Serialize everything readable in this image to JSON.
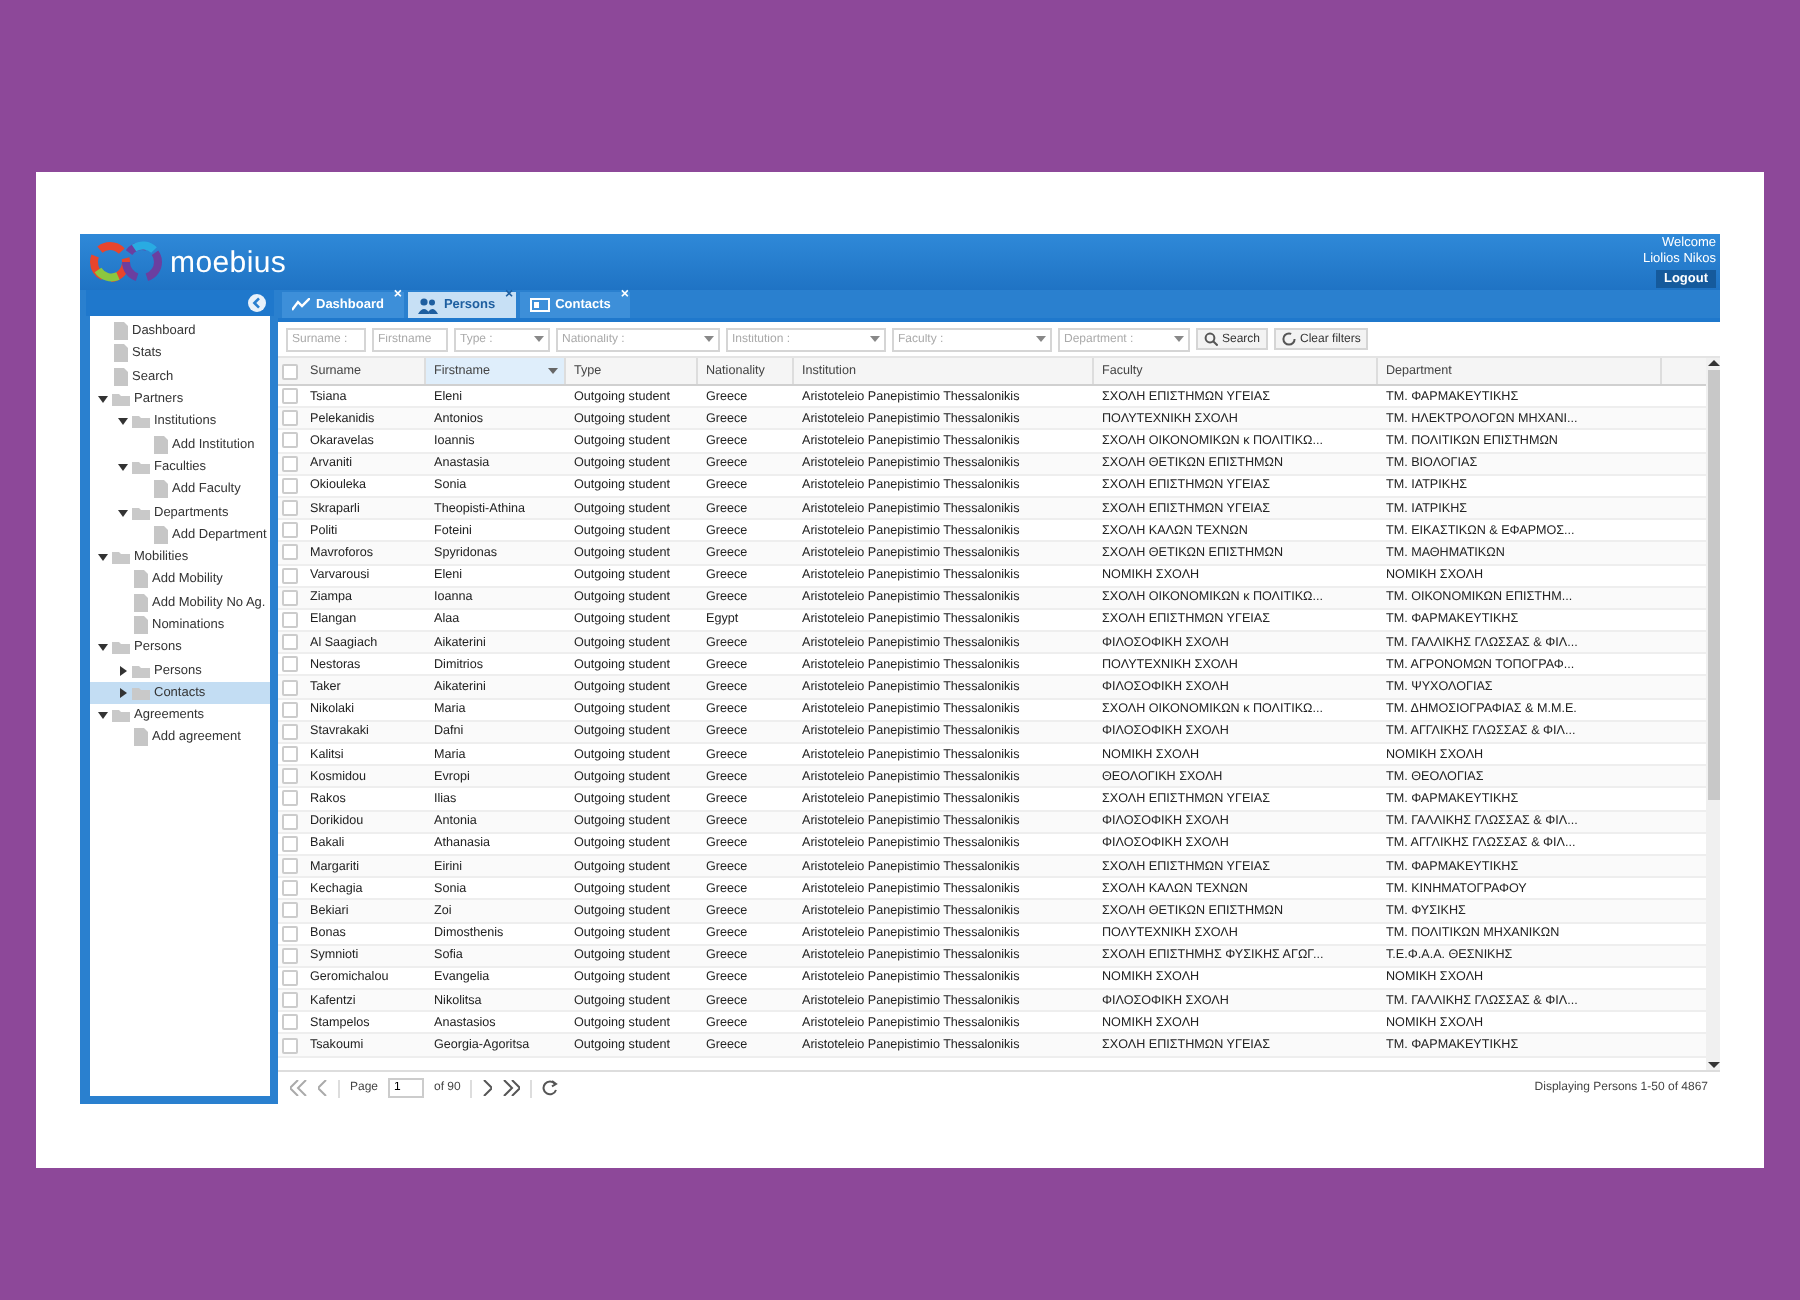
{
  "header": {
    "logo": "moebius",
    "welcome": "Welcome",
    "user": "Liolios Nikos",
    "logout": "Logout"
  },
  "tabs": [
    {
      "label": "Dashboard",
      "close": "×",
      "selected": false
    },
    {
      "label": "Persons",
      "close": "×",
      "selected": true
    },
    {
      "label": "Contacts",
      "close": "×",
      "selected": false
    }
  ],
  "sidebar": {
    "items": [
      {
        "label": "Dashboard",
        "kind": "leaf",
        "selected": false
      },
      {
        "label": "Stats",
        "kind": "leaf",
        "selected": false
      },
      {
        "label": "Search",
        "kind": "leaf",
        "selected": false
      },
      {
        "label": "Partners",
        "kind": "folder",
        "expanded": true,
        "selected": false,
        "children": [
          {
            "label": "Institutions",
            "kind": "folder",
            "expanded": true,
            "selected": false,
            "children": [
              {
                "label": "Add Institution",
                "kind": "leaf",
                "selected": false
              }
            ]
          },
          {
            "label": "Faculties",
            "kind": "folder",
            "expanded": true,
            "selected": false,
            "children": [
              {
                "label": "Add Faculty",
                "kind": "leaf",
                "selected": false
              }
            ]
          },
          {
            "label": "Departments",
            "kind": "folder",
            "expanded": true,
            "selected": false,
            "children": [
              {
                "label": "Add Department",
                "kind": "leaf",
                "selected": false
              }
            ]
          }
        ]
      },
      {
        "label": "Mobilities",
        "kind": "folder",
        "expanded": true,
        "selected": false,
        "children": [
          {
            "label": "Add Mobility",
            "kind": "leaf",
            "selected": false
          },
          {
            "label": "Add Mobility No Ag.",
            "kind": "leaf",
            "selected": false
          },
          {
            "label": "Nominations",
            "kind": "leaf",
            "selected": false
          }
        ]
      },
      {
        "label": "Persons",
        "kind": "folder",
        "expanded": true,
        "selected": false,
        "children": [
          {
            "label": "Persons",
            "kind": "folder",
            "expanded": false,
            "selected": false
          },
          {
            "label": "Contacts",
            "kind": "folder",
            "expanded": false,
            "selected": true
          }
        ]
      },
      {
        "label": "Agreements",
        "kind": "folder",
        "expanded": true,
        "selected": false,
        "children": [
          {
            "label": "Add agreement",
            "kind": "leaf",
            "selected": false
          }
        ]
      }
    ]
  },
  "filters": [
    {
      "placeholder": "Surname :",
      "kind": "text"
    },
    {
      "placeholder": "Firstname",
      "kind": "text"
    },
    {
      "placeholder": "Type :",
      "kind": "combo"
    },
    {
      "placeholder": "Nationality :",
      "kind": "combo"
    },
    {
      "placeholder": "Institution :",
      "kind": "combo"
    },
    {
      "placeholder": "Faculty :",
      "kind": "combo"
    },
    {
      "placeholder": "Department :",
      "kind": "combo"
    }
  ],
  "filter_buttons": [
    {
      "label": "Search",
      "kind": "search"
    },
    {
      "label": "Clear filters",
      "kind": "clear"
    }
  ],
  "table": {
    "select_all": {
      "checked": false
    },
    "columns": [
      {
        "label": "Surname",
        "active": false
      },
      {
        "label": "Firstname",
        "active": true
      },
      {
        "label": "Type",
        "active": false
      },
      {
        "label": "Nationality",
        "active": false
      },
      {
        "label": "Institution",
        "active": false
      },
      {
        "label": "Faculty",
        "active": false
      },
      {
        "label": "Department",
        "active": false
      }
    ],
    "rows": [
      {
        "checked": false,
        "cells": [
          "Tsiana",
          "Eleni",
          "Outgoing student",
          "Greece",
          "Aristoteleio Panepistimio Thessalonikis",
          "ΣΧΟΛΗ ΕΠΙΣΤΗΜΩΝ ΥΓΕΙΑΣ",
          "ΤΜ. ΦΑΡΜΑΚΕΥΤΙΚΗΣ"
        ]
      },
      {
        "checked": false,
        "cells": [
          "Pelekanidis",
          "Antonios",
          "Outgoing student",
          "Greece",
          "Aristoteleio Panepistimio Thessalonikis",
          "ΠΟΛΥΤΕΧΝΙΚΗ ΣΧΟΛΗ",
          "ΤΜ. ΗΛΕΚΤΡΟΛΟΓΩΝ ΜΗΧΑΝΙ..."
        ]
      },
      {
        "checked": false,
        "cells": [
          "Okaravelas",
          "Ioannis",
          "Outgoing student",
          "Greece",
          "Aristoteleio Panepistimio Thessalonikis",
          "ΣΧΟΛΗ ΟΙΚΟΝΟΜΙΚΩΝ κ ΠΟΛΙΤΙΚΩ...",
          "ΤΜ. ΠΟΛΙΤΙΚΩΝ ΕΠΙΣΤΗΜΩΝ"
        ]
      },
      {
        "checked": false,
        "cells": [
          "Arvaniti",
          "Anastasia",
          "Outgoing student",
          "Greece",
          "Aristoteleio Panepistimio Thessalonikis",
          "ΣΧΟΛΗ ΘΕΤΙΚΩΝ ΕΠΙΣΤΗΜΩΝ",
          "ΤΜ. ΒΙΟΛΟΓΙΑΣ"
        ]
      },
      {
        "checked": false,
        "cells": [
          "Okiouleka",
          "Sonia",
          "Outgoing student",
          "Greece",
          "Aristoteleio Panepistimio Thessalonikis",
          "ΣΧΟΛΗ ΕΠΙΣΤΗΜΩΝ ΥΓΕΙΑΣ",
          "ΤΜ. ΙΑΤΡΙΚΗΣ"
        ]
      },
      {
        "checked": false,
        "cells": [
          "Skraparli",
          "Theopisti-Athina",
          "Outgoing student",
          "Greece",
          "Aristoteleio Panepistimio Thessalonikis",
          "ΣΧΟΛΗ ΕΠΙΣΤΗΜΩΝ ΥΓΕΙΑΣ",
          "ΤΜ. ΙΑΤΡΙΚΗΣ"
        ]
      },
      {
        "checked": false,
        "cells": [
          "Politi",
          "Foteini",
          "Outgoing student",
          "Greece",
          "Aristoteleio Panepistimio Thessalonikis",
          "ΣΧΟΛΗ ΚΑΛΩΝ ΤΕΧΝΩΝ",
          "ΤΜ. ΕΙΚΑΣΤΙΚΩΝ & ΕΦΑΡΜΟΣ..."
        ]
      },
      {
        "checked": false,
        "cells": [
          "Mavroforos",
          "Spyridonas",
          "Outgoing student",
          "Greece",
          "Aristoteleio Panepistimio Thessalonikis",
          "ΣΧΟΛΗ ΘΕΤΙΚΩΝ ΕΠΙΣΤΗΜΩΝ",
          "ΤΜ. ΜΑΘΗΜΑΤΙΚΩΝ"
        ]
      },
      {
        "checked": false,
        "cells": [
          "Varvarousi",
          "Eleni",
          "Outgoing student",
          "Greece",
          "Aristoteleio Panepistimio Thessalonikis",
          "ΝΟΜΙΚΗ ΣΧΟΛΗ",
          "ΝΟΜΙΚΗ ΣΧΟΛΗ"
        ]
      },
      {
        "checked": false,
        "cells": [
          "Ziampa",
          "Ioanna",
          "Outgoing student",
          "Greece",
          "Aristoteleio Panepistimio Thessalonikis",
          "ΣΧΟΛΗ ΟΙΚΟΝΟΜΙΚΩΝ κ ΠΟΛΙΤΙΚΩ...",
          "ΤΜ. ΟΙΚΟΝΟΜΙΚΩΝ ΕΠΙΣΤΗΜ..."
        ]
      },
      {
        "checked": false,
        "cells": [
          "Elangan",
          "Alaa",
          "Outgoing student",
          "Egypt",
          "Aristoteleio Panepistimio Thessalonikis",
          "ΣΧΟΛΗ ΕΠΙΣΤΗΜΩΝ ΥΓΕΙΑΣ",
          "ΤΜ. ΦΑΡΜΑΚΕΥΤΙΚΗΣ"
        ]
      },
      {
        "checked": false,
        "cells": [
          "Al Saagiach",
          "Aikaterini",
          "Outgoing student",
          "Greece",
          "Aristoteleio Panepistimio Thessalonikis",
          "ΦΙΛΟΣΟΦΙΚΗ ΣΧΟΛΗ",
          "ΤΜ. ΓΑΛΛΙΚΗΣ ΓΛΩΣΣΑΣ & ΦΙΛ..."
        ]
      },
      {
        "checked": false,
        "cells": [
          "Nestoras",
          "Dimitrios",
          "Outgoing student",
          "Greece",
          "Aristoteleio Panepistimio Thessalonikis",
          "ΠΟΛΥΤΕΧΝΙΚΗ ΣΧΟΛΗ",
          "ΤΜ. ΑΓΡΟΝΟΜΩΝ ΤΟΠΟΓΡΑΦ..."
        ]
      },
      {
        "checked": false,
        "cells": [
          "Taker",
          "Aikaterini",
          "Outgoing student",
          "Greece",
          "Aristoteleio Panepistimio Thessalonikis",
          "ΦΙΛΟΣΟΦΙΚΗ ΣΧΟΛΗ",
          "ΤΜ. ΨΥΧΟΛΟΓΙΑΣ"
        ]
      },
      {
        "checked": false,
        "cells": [
          "Nikolaki",
          "Maria",
          "Outgoing student",
          "Greece",
          "Aristoteleio Panepistimio Thessalonikis",
          "ΣΧΟΛΗ ΟΙΚΟΝΟΜΙΚΩΝ κ ΠΟΛΙΤΙΚΩ...",
          "ΤΜ. ΔΗΜΟΣΙΟΓΡΑΦΙΑΣ & Μ.Μ.Ε."
        ]
      },
      {
        "checked": false,
        "cells": [
          "Stavrakaki",
          "Dafni",
          "Outgoing student",
          "Greece",
          "Aristoteleio Panepistimio Thessalonikis",
          "ΦΙΛΟΣΟΦΙΚΗ ΣΧΟΛΗ",
          "ΤΜ. ΑΓΓΛΙΚΗΣ ΓΛΩΣΣΑΣ & ΦΙΛ..."
        ]
      },
      {
        "checked": false,
        "cells": [
          "Kalitsi",
          "Maria",
          "Outgoing student",
          "Greece",
          "Aristoteleio Panepistimio Thessalonikis",
          "ΝΟΜΙΚΗ ΣΧΟΛΗ",
          "ΝΟΜΙΚΗ ΣΧΟΛΗ"
        ]
      },
      {
        "checked": false,
        "cells": [
          "Kosmidou",
          "Evropi",
          "Outgoing student",
          "Greece",
          "Aristoteleio Panepistimio Thessalonikis",
          "ΘΕΟΛΟΓΙΚΗ ΣΧΟΛΗ",
          "ΤΜ. ΘΕΟΛΟΓΙΑΣ"
        ]
      },
      {
        "checked": false,
        "cells": [
          "Rakos",
          "Ilias",
          "Outgoing student",
          "Greece",
          "Aristoteleio Panepistimio Thessalonikis",
          "ΣΧΟΛΗ ΕΠΙΣΤΗΜΩΝ ΥΓΕΙΑΣ",
          "ΤΜ. ΦΑΡΜΑΚΕΥΤΙΚΗΣ"
        ]
      },
      {
        "checked": false,
        "cells": [
          "Dorikidou",
          "Antonia",
          "Outgoing student",
          "Greece",
          "Aristoteleio Panepistimio Thessalonikis",
          "ΦΙΛΟΣΟΦΙΚΗ ΣΧΟΛΗ",
          "ΤΜ. ΓΑΛΛΙΚΗΣ ΓΛΩΣΣΑΣ & ΦΙΛ..."
        ]
      },
      {
        "checked": false,
        "cells": [
          "Bakali",
          "Athanasia",
          "Outgoing student",
          "Greece",
          "Aristoteleio Panepistimio Thessalonikis",
          "ΦΙΛΟΣΟΦΙΚΗ ΣΧΟΛΗ",
          "ΤΜ. ΑΓΓΛΙΚΗΣ ΓΛΩΣΣΑΣ & ΦΙΛ..."
        ]
      },
      {
        "checked": false,
        "cells": [
          "Margariti",
          "Eirini",
          "Outgoing student",
          "Greece",
          "Aristoteleio Panepistimio Thessalonikis",
          "ΣΧΟΛΗ ΕΠΙΣΤΗΜΩΝ ΥΓΕΙΑΣ",
          "ΤΜ. ΦΑΡΜΑΚΕΥΤΙΚΗΣ"
        ]
      },
      {
        "checked": false,
        "cells": [
          "Kechagia",
          "Sonia",
          "Outgoing student",
          "Greece",
          "Aristoteleio Panepistimio Thessalonikis",
          "ΣΧΟΛΗ ΚΑΛΩΝ ΤΕΧΝΩΝ",
          "ΤΜ. ΚΙΝΗΜΑΤΟΓΡΑΦΟΥ"
        ]
      },
      {
        "checked": false,
        "cells": [
          "Bekiari",
          "Zoi",
          "Outgoing student",
          "Greece",
          "Aristoteleio Panepistimio Thessalonikis",
          "ΣΧΟΛΗ ΘΕΤΙΚΩΝ ΕΠΙΣΤΗΜΩΝ",
          "ΤΜ. ΦΥΣΙΚΗΣ"
        ]
      },
      {
        "checked": false,
        "cells": [
          "Bonas",
          "Dimosthenis",
          "Outgoing student",
          "Greece",
          "Aristoteleio Panepistimio Thessalonikis",
          "ΠΟΛΥΤΕΧΝΙΚΗ ΣΧΟΛΗ",
          "ΤΜ. ΠΟΛΙΤΙΚΩΝ ΜΗΧΑΝΙΚΩΝ"
        ]
      },
      {
        "checked": false,
        "cells": [
          "Symnioti",
          "Sofia",
          "Outgoing student",
          "Greece",
          "Aristoteleio Panepistimio Thessalonikis",
          "ΣΧΟΛΗ ΕΠΙΣΤΗΜΗΣ ΦΥΣΙΚΗΣ ΑΓΩΓ...",
          "Τ.Ε.Φ.Α.Α. ΘΕΣΝΙΚΗΣ"
        ]
      },
      {
        "checked": false,
        "cells": [
          "Geromichalou",
          "Evangelia",
          "Outgoing student",
          "Greece",
          "Aristoteleio Panepistimio Thessalonikis",
          "ΝΟΜΙΚΗ ΣΧΟΛΗ",
          "ΝΟΜΙΚΗ ΣΧΟΛΗ"
        ]
      },
      {
        "checked": false,
        "cells": [
          "Kafentzi",
          "Nikolitsa",
          "Outgoing student",
          "Greece",
          "Aristoteleio Panepistimio Thessalonikis",
          "ΦΙΛΟΣΟΦΙΚΗ ΣΧΟΛΗ",
          "ΤΜ. ΓΑΛΛΙΚΗΣ ΓΛΩΣΣΑΣ & ΦΙΛ..."
        ]
      },
      {
        "checked": false,
        "cells": [
          "Stampelos",
          "Anastasios",
          "Outgoing student",
          "Greece",
          "Aristoteleio Panepistimio Thessalonikis",
          "ΝΟΜΙΚΗ ΣΧΟΛΗ",
          "ΝΟΜΙΚΗ ΣΧΟΛΗ"
        ]
      },
      {
        "checked": false,
        "cells": [
          "Tsakoumi",
          "Georgia-Agoritsa",
          "Outgoing student",
          "Greece",
          "Aristoteleio Panepistimio Thessalonikis",
          "ΣΧΟΛΗ ΕΠΙΣΤΗΜΩΝ ΥΓΕΙΑΣ",
          "ΤΜ. ΦΑΡΜΑΚΕΥΤΙΚΗΣ"
        ]
      }
    ]
  },
  "pager": {
    "page_label": "Page",
    "page": "1",
    "of": "of 90",
    "summary": "Displaying Persons 1-50 of 4867"
  }
}
